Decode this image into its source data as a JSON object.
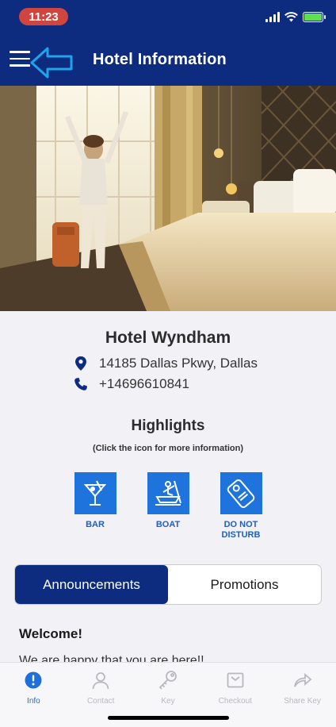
{
  "status_bar": {
    "time": "11:23"
  },
  "header": {
    "title": "Hotel Information"
  },
  "hotel": {
    "name": "Hotel Wyndham",
    "address": "14185 Dallas Pkwy, Dallas",
    "phone": "+14696610841"
  },
  "highlights": {
    "title": "Highlights",
    "subtitle": "(Click the icon for more information)",
    "items": [
      {
        "label": "BAR",
        "icon": "cocktail-icon"
      },
      {
        "label": "BOAT",
        "icon": "rowboat-icon"
      },
      {
        "label": "DO NOT DISTURB",
        "icon": "door-hanger-icon"
      }
    ]
  },
  "segment": {
    "tabs": [
      {
        "label": "Announcements",
        "selected": true
      },
      {
        "label": "Promotions",
        "selected": false
      }
    ]
  },
  "announcement": {
    "heading": "Welcome!",
    "body": "We are happy that you are here!!"
  },
  "tabbar": {
    "items": [
      {
        "label": "Info",
        "icon": "info-icon",
        "active": true
      },
      {
        "label": "Contact",
        "icon": "person-icon",
        "active": false
      },
      {
        "label": "Key",
        "icon": "key-icon",
        "active": false
      },
      {
        "label": "Checkout",
        "icon": "checkout-icon",
        "active": false
      },
      {
        "label": "Share Key",
        "icon": "share-icon",
        "active": false
      }
    ]
  },
  "colors": {
    "header_bg": "#0d2c80",
    "accent": "#1e74dc",
    "time_pill": "#d0463f",
    "annotation_arrow": "#1ea4ea"
  }
}
